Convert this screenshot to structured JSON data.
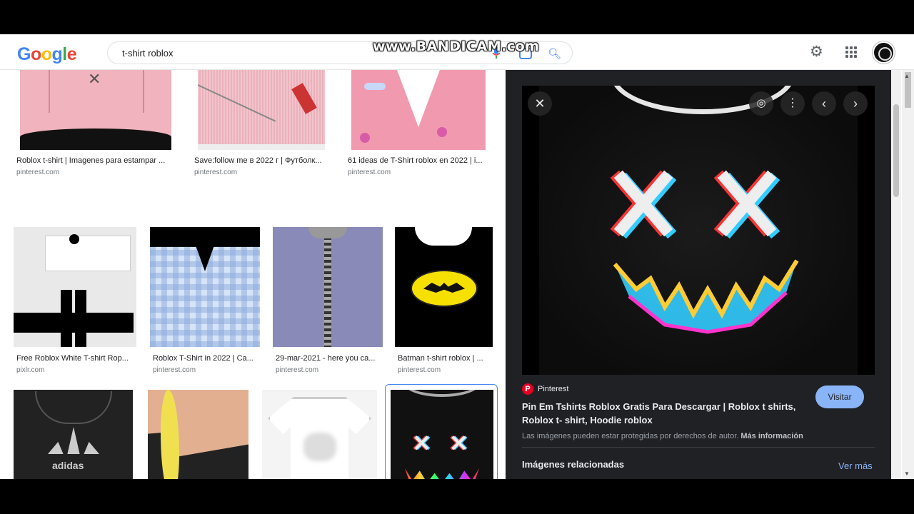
{
  "search": {
    "query": "t-shirt roblox"
  },
  "watermark": "www.BANDICAM.com",
  "logo": [
    "G",
    "o",
    "o",
    "g",
    "l",
    "e"
  ],
  "row1": [
    {
      "caption": "Roblox t-shirt | Imagenes para estampar ...",
      "source": "pinterest.com"
    },
    {
      "caption": "Save:follow me в 2022 г | Футболк...",
      "source": "pinterest.com"
    },
    {
      "caption": "61 ideas de T-Shirt roblox en 2022 | i...",
      "source": "pinterest.com"
    }
  ],
  "row2": [
    {
      "caption": "Free Roblox White T-shirt Rop...",
      "source": "pixlr.com"
    },
    {
      "caption": "Roblox T-Shirt in 2022 | Ca...",
      "source": "pinterest.com"
    },
    {
      "caption": "29-mar-2021 - here you ca...",
      "source": "pinterest.com"
    },
    {
      "caption": "Batman t-shirt roblox | ...",
      "source": "pinterest.com"
    }
  ],
  "row3_text": {
    "adidas": "adidas"
  },
  "panel": {
    "source_name": "Pinterest",
    "pin_letter": "P",
    "title": "Pin Em Tshirts Roblox Gratis Para Descargar | Roblox t shirts, Roblox t- shirt, Hoodie roblox",
    "visit": "Visitar",
    "copyright": "Las imágenes pueden estar protegidas por derechos de autor.",
    "copyright_link": "Más información",
    "related": "Imágenes relacionadas",
    "more": "Ver más"
  },
  "colors": {
    "accent": "#8ab4f8",
    "panel_bg": "#202124",
    "pinterest": "#e60023"
  }
}
